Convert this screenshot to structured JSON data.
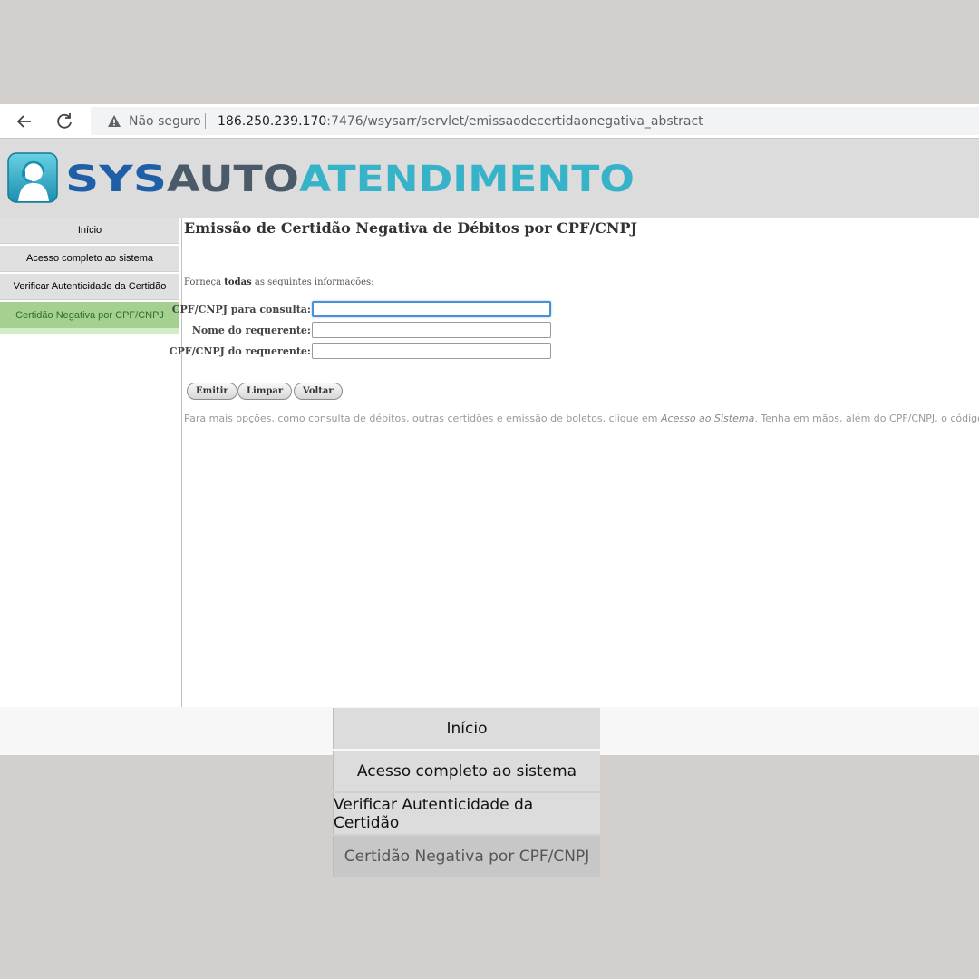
{
  "browser": {
    "security_label": "Não seguro",
    "url_host": "186.250.239.170",
    "url_rest": ":7476/wsysarr/servlet/emissaodecertidaonegativa_abstract"
  },
  "banner": {
    "logo_part1": "SYS",
    "logo_part2": "AUTO",
    "logo_part3": "ATENDIMENTO",
    "colors": {
      "sys": "#1f5fa8",
      "auto": "#4a5a68",
      "atendimento": "#37b3c9"
    }
  },
  "sidebar": {
    "items": [
      {
        "label": "Início"
      },
      {
        "label": "Acesso completo ao sistema"
      },
      {
        "label": "Verificar Autenticidade da Certidão"
      },
      {
        "label": "Certidão Negativa por CPF/CNPJ"
      }
    ],
    "active_index": 3
  },
  "content": {
    "title": "Emissão de Certidão Negativa de Débitos por CPF/CNPJ",
    "instruction_pre": "Forneça ",
    "instruction_bold": "todas",
    "instruction_post": " as seguintes informações:",
    "fields": [
      {
        "label": "CPF/CNPJ para consulta:",
        "value": ""
      },
      {
        "label": "Nome do requerente:",
        "value": ""
      },
      {
        "label": "CPF/CNPJ do requerente:",
        "value": ""
      }
    ],
    "buttons": {
      "emitir": "Emitir",
      "limpar": "Limpar",
      "voltar": "Voltar"
    },
    "footnote_pre": "Para mais opções, como consulta de débitos, outras certidões e emissão de boletos, clique em ",
    "footnote_italic": "Acesso ao Sistema",
    "footnote_post": ". Tenha em mãos, além do CPF/CNPJ, o código do"
  },
  "zoom_menu": {
    "items": [
      {
        "label": "Início"
      },
      {
        "label": "Acesso completo ao sistema"
      },
      {
        "label": "Verificar Autenticidade da Certidão"
      },
      {
        "label": "Certidão Negativa por CPF/CNPJ"
      }
    ]
  }
}
